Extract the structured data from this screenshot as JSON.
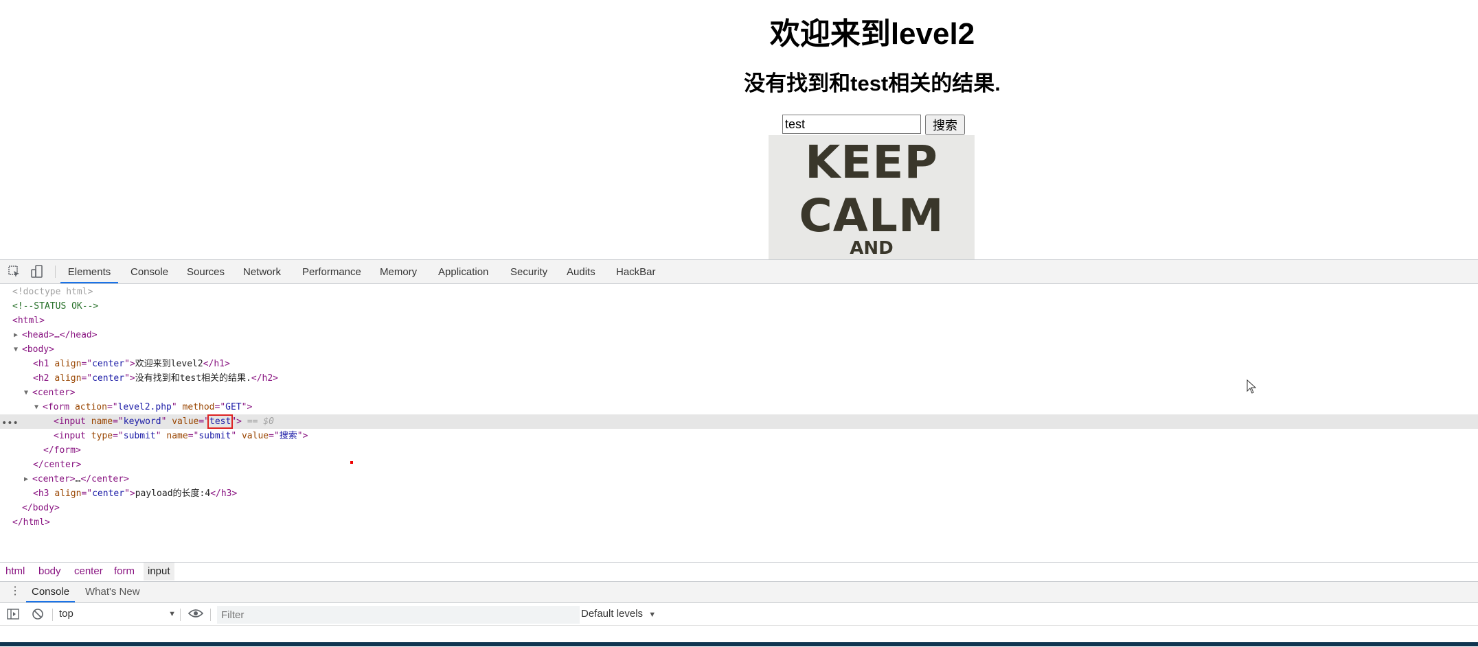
{
  "page": {
    "h1": "欢迎来到level2",
    "h2": "没有找到和test相关的结果.",
    "keyword_value": "test",
    "submit_label": "搜索",
    "poster": [
      "KEEP",
      "CALM",
      "AND"
    ]
  },
  "devtools": {
    "tabs": [
      "Elements",
      "Console",
      "Sources",
      "Network",
      "Performance",
      "Memory",
      "Application",
      "Security",
      "Audits",
      "HackBar"
    ],
    "active_tab": "Elements",
    "dom": {
      "doctype": "<!doctype html>",
      "comment": "<!--STATUS OK-->",
      "html_open": "<html>",
      "head": "<head>…</head>",
      "body_open": "<body>",
      "h1_text": "欢迎来到level2",
      "h2_text": "没有找到和test相关的结果.",
      "form_action": "level2.php",
      "form_method": "GET",
      "input_name": "keyword",
      "input_value": "test",
      "selected_marker": "== $0",
      "submit_type": "submit",
      "submit_name": "submit",
      "submit_value": "搜索",
      "center_collapsed": "…",
      "h3_text": "payload的长度:4"
    },
    "breadcrumb": [
      "html",
      "body",
      "center",
      "form",
      "input"
    ],
    "drawer_tabs": [
      "Console",
      "What's New"
    ],
    "console": {
      "context": "top",
      "filter_placeholder": "Filter",
      "levels": "Default levels"
    }
  }
}
